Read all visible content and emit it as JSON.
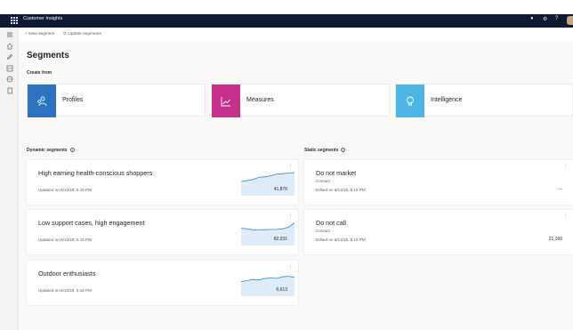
{
  "app": {
    "title": "Customer Insights"
  },
  "header_icons": [
    "bell-icon",
    "gear-icon",
    "help-icon",
    "avatar"
  ],
  "nav_icons": [
    "hamburger-icon",
    "home-icon",
    "pencil-icon",
    "segments-icon",
    "globe-icon",
    "document-icon"
  ],
  "command_bar": {
    "new_segment": "New segment",
    "update_segments": "Update segments"
  },
  "page": {
    "title": "Segments",
    "create_from": "Create from"
  },
  "tiles": [
    {
      "label": "Profiles",
      "icon": "profiles-icon",
      "color": "#2b73c2"
    },
    {
      "label": "Measures",
      "icon": "measures-chart-icon",
      "color": "#c6308d"
    },
    {
      "label": "Intelligence",
      "icon": "lightbulb-icon",
      "color": "#4cb5e6"
    }
  ],
  "dynamic_segments": {
    "label": "Dynamic segments",
    "items": [
      {
        "title": "High earning health-conscious shoppers",
        "updated": "Updated on 6/13/18, 5:15 PM",
        "count": "41,876",
        "trend": [
          0.15,
          0.25,
          0.35,
          0.55,
          0.6,
          0.7,
          0.85,
          0.9,
          0.95,
          1.0
        ]
      },
      {
        "title": "Low support cases, high engagement",
        "updated": "Updated on 6/13/18, 5:15 PM",
        "count": "82,031",
        "trend": [
          0.45,
          0.4,
          0.3,
          0.3,
          0.32,
          0.33,
          0.34,
          0.4,
          0.55,
          0.95
        ]
      },
      {
        "title": "Outdoor enthusiasts",
        "updated": "Updated on 6/13/18, 5:15 PM",
        "count": "6,613",
        "trend": [
          0.2,
          0.3,
          0.4,
          0.35,
          0.5,
          0.55,
          0.5,
          0.65,
          0.7,
          0.6
        ]
      }
    ]
  },
  "static_segments": {
    "label": "Static segments",
    "items": [
      {
        "title": "Do not market",
        "type": "Contact",
        "edited": "Edited on 6/13/18, 5:15 PM",
        "count": "---"
      },
      {
        "title": "Do not call",
        "type": "Contact",
        "edited": "Edited on 6/13/18, 5:15 PM",
        "count": "21,160"
      }
    ]
  },
  "colors": {
    "header": "#0e1a33",
    "spark_line": "#2b88d8",
    "spark_fill": "#c7e0f4"
  }
}
